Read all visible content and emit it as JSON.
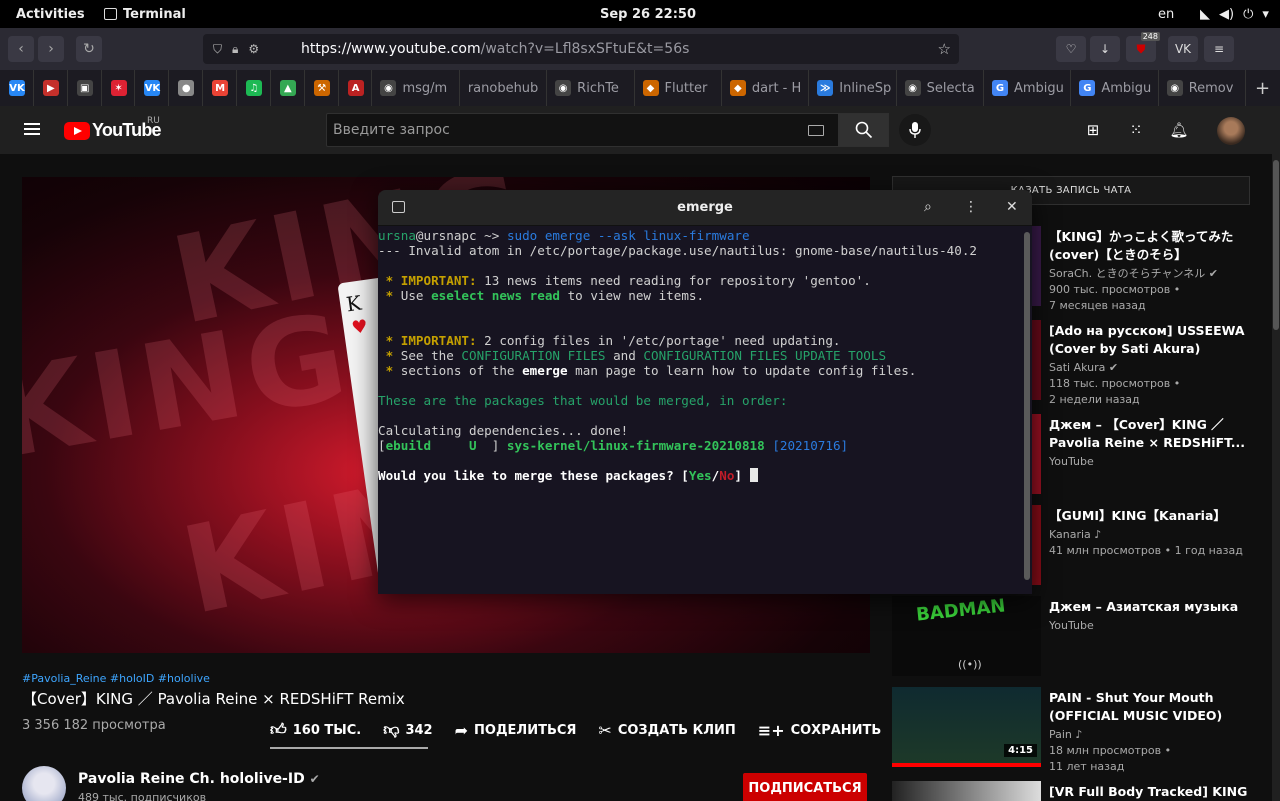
{
  "gnome": {
    "activities": "Activities",
    "app_name": "Terminal",
    "clock": "Sep 26  22:50",
    "lang": "en"
  },
  "browser": {
    "url_host": "https://www.youtube.com",
    "url_rest": "/watch?v=Lfl8sxSFtuE&t=56s",
    "badge": "248",
    "tabs": [
      {
        "fav": "VK",
        "color": "#2787f5",
        "label": ""
      },
      {
        "fav": "▶",
        "color": "#c4302b",
        "label": ""
      },
      {
        "fav": "▣",
        "color": "#444",
        "label": ""
      },
      {
        "fav": "✶",
        "color": "#d23",
        "label": ""
      },
      {
        "fav": "VK",
        "color": "#2787f5",
        "label": ""
      },
      {
        "fav": "●",
        "color": "#888",
        "label": ""
      },
      {
        "fav": "M",
        "color": "#ea4335",
        "label": ""
      },
      {
        "fav": "♫",
        "color": "#1db954",
        "label": ""
      },
      {
        "fav": "▲",
        "color": "#34a853",
        "label": ""
      },
      {
        "fav": "⚒",
        "color": "#c60",
        "label": ""
      },
      {
        "fav": "A",
        "color": "#b22",
        "label": ""
      },
      {
        "fav": "◉",
        "color": "#444",
        "label": "msg/m"
      },
      {
        "fav": "",
        "color": "#444",
        "label": "ranobehub"
      },
      {
        "fav": "◉",
        "color": "#444",
        "label": "RichTe"
      },
      {
        "fav": "◆",
        "color": "#c60",
        "label": "Flutter"
      },
      {
        "fav": "◆",
        "color": "#c60",
        "label": "dart - H"
      },
      {
        "fav": "≫",
        "color": "#2a7bde",
        "label": "InlineSp"
      },
      {
        "fav": "◉",
        "color": "#444",
        "label": "Selecta"
      },
      {
        "fav": "G",
        "color": "#4285f4",
        "label": "Ambigu"
      },
      {
        "fav": "G",
        "color": "#4285f4",
        "label": "Ambigu"
      },
      {
        "fav": "◉",
        "color": "#444",
        "label": "Remov"
      }
    ]
  },
  "youtube": {
    "logo": "YouTube",
    "region": "RU",
    "search_placeholder": "Введите запрос",
    "video": {
      "tags": "#Pavolia_Reine #holoID #hololive",
      "title": "【Cover】KING ／ Pavolia Reine × REDSHiFT Remix",
      "views": "3 356 182 просмотра",
      "likes": "160 ТЫС.",
      "dislikes": "342",
      "share": "ПОДЕЛИТЬСЯ",
      "clip": "СОЗДАТЬ КЛИП",
      "save": "СОХРАНИТЬ",
      "more": "...",
      "channel": "Pavolia Reine Ch. hololive-ID",
      "subs": "489 тыс. подписчиков",
      "subscribe": "ПОДПИСАТЬСЯ"
    },
    "chat_label": "КАЗАТЬ ЗАПИСЬ ЧАТА",
    "recommendations": [
      {
        "title": "【KING】かっこよく歌ってみた (cover)【ときのそら】",
        "channel": "SoraCh. ときのそらチャンネル ✔",
        "views": "900 тыс. просмотров •",
        "age": "7 месяцев назад"
      },
      {
        "title": "[Ado на русском] USSEEWA (Cover by Sati Akura)",
        "channel": "Sati Akura ✔",
        "views": "118 тыс. просмотров •",
        "age": "2 недели назад"
      },
      {
        "title": "Джем – 【Cover】KING ／ Pavolia Reine × REDSHiFT...",
        "channel": "YouTube",
        "views": "",
        "age": ""
      },
      {
        "title": "【GUMI】KING【Kanaria】",
        "channel": "Kanaria ♪",
        "views": "41 млн просмотров • 1 год назад",
        "age": ""
      },
      {
        "title": "Джем – Азиатская музыка",
        "channel": "YouTube",
        "views": "",
        "age": "",
        "thumb_text": "BADMAN"
      },
      {
        "title": "PAIN - Shut Your Mouth (OFFICIAL MUSIC VIDEO)",
        "channel": "Pain ♪",
        "views": "18 млн просмотров •",
        "age": "11 лет назад",
        "duration": "4:15"
      },
      {
        "title": "[VR Full Body Tracked] KING ／",
        "channel": "",
        "views": "",
        "age": ""
      }
    ]
  },
  "terminal": {
    "title": "emerge",
    "prompt_user": "ursna",
    "prompt_host": "@ursnapc",
    "prompt_arrow": " ~> ",
    "command": "sudo emerge --ask linux-firmware",
    "line_invalid": "--- Invalid atom in /etc/portage/package.use/nautilus: gnome-base/nautilus-40.2",
    "star": " * ",
    "important": "IMPORTANT:",
    "news1": " 13 news items need reading for repository 'gentoo'.",
    "use": "Use ",
    "eselect": "eselect news read",
    "news2": " to view new items.",
    "cfg1": " 2 config files in '/etc/portage' need updating.",
    "see": "See the ",
    "cfgfiles": "CONFIGURATION FILES",
    "and": " and ",
    "cfgupdate": "CONFIGURATION FILES UPDATE TOOLS",
    "sections": "sections of the ",
    "emerge": "emerge",
    "manpage": " man page to learn how to update config files.",
    "packages": "These are the packages that would be merged, in order:",
    "calc": "Calculating dependencies... done!",
    "ebuild_open": "[",
    "ebuild": "ebuild     U  ",
    "ebuild_close": "] ",
    "pkg": "sys-kernel/linux-firmware-20210818",
    "oldver": "[20210716]",
    "question": "Would you like to merge these packages? ",
    "yes": "Yes",
    "no": "No"
  }
}
